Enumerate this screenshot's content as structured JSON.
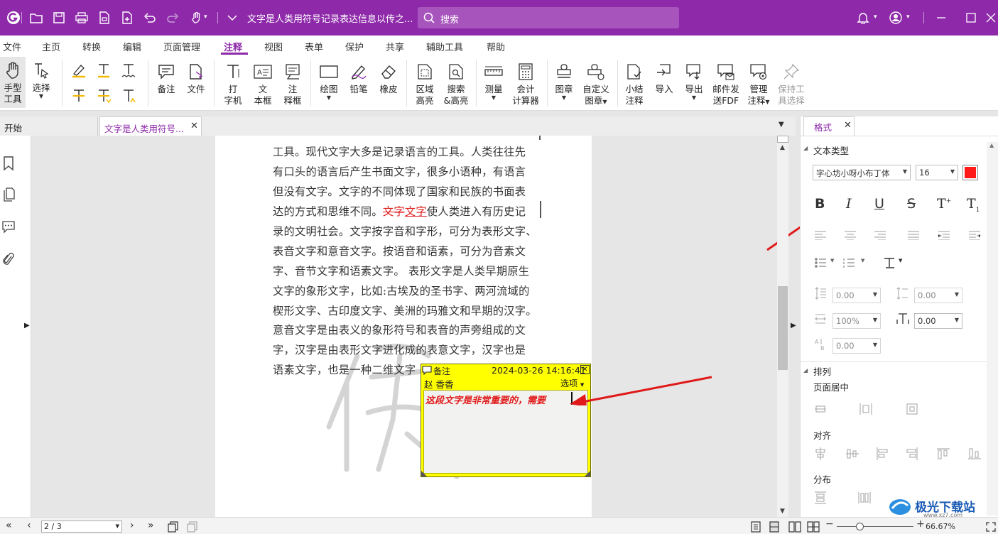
{
  "titlebar": {
    "doc_title": "文字是人类用符号记录表达信息以传之...",
    "search_placeholder": "搜索"
  },
  "menu": [
    "文件",
    "主页",
    "转换",
    "编辑",
    "页面管理",
    "注释",
    "视图",
    "表单",
    "保护",
    "共享",
    "辅助工具",
    "帮助"
  ],
  "toolbar": {
    "hand_l1": "手型",
    "hand_l2": "工具",
    "select": "选择",
    "note": "备注",
    "file": "文件",
    "typewriter_l1": "打",
    "typewriter_l2": "字机",
    "textbox_l1": "文",
    "textbox_l2": "本框",
    "callout_l1": "注",
    "callout_l2": "释框",
    "draw": "绘图",
    "pencil": "铅笔",
    "eraser": "橡皮",
    "area_l1": "区域",
    "area_l2": "高亮",
    "searchhl_l1": "搜索",
    "searchhl_l2": "&高亮",
    "measure": "测量",
    "calc_l1": "会计",
    "calc_l2": "计算器",
    "stamp": "图章",
    "customstamp_l1": "自定义",
    "customstamp_l2": "图章",
    "summary_l1": "小结",
    "summary_l2": "注释",
    "import": "导入",
    "export": "导出",
    "email_l1": "邮件发",
    "email_l2": "送FDF",
    "manage_l1": "管理",
    "manage_l2": "注释",
    "keep_l1": "保持工",
    "keep_l2": "具选择"
  },
  "tabs": {
    "home": "开始",
    "doc": "文字是人类用符号..."
  },
  "page_lines": [
    "工具。现代文字大多是记录语言的工具。人类往往先",
    "有口头的语言后产生书面文字，很多小语种，有语言",
    "但没有文字。文字的不同体现了国家和民族的书面表",
    "达的方式和思维不同。",
    "录的文明社会。文字按字音和字形，可分为表形文字、",
    "表音文字和意音文字。按语音和语素，可分为音素文",
    "字、音节文字和语素文字。 表形文字是人类早期原生",
    "文字的象形文字，比如:古埃及的圣书字、两河流域的",
    "楔形文字、古印度文字、美洲的玛雅文和早期的汉字。",
    "意音文字是由表义的象形符号和表音的声旁组成的文",
    "字，汉字是由表形文字进化成的表意文字，汉字也是",
    "语素文字，也是一种二维文字"
  ],
  "page_markup": {
    "strike": "文字",
    "underline": "文字",
    "after": "使人类进入有历史记"
  },
  "note": {
    "title": "备注",
    "datetime": "2024-03-26 14:16:41",
    "author": "赵 香香",
    "options": "选项",
    "content": "这段文字是非常重要的，需要"
  },
  "right_panel": {
    "tab": "格式",
    "text_type": "文本类型",
    "font": "字心坊小呀小布丁体",
    "size": "16",
    "text_color": "#ff1a1a",
    "line_spacing_1": "0.00",
    "line_spacing_2": "0.00",
    "scale": "100%",
    "char_space": "0.00",
    "word_space": "0.00",
    "arrange": "排列",
    "page_center": "页面居中",
    "align": "对齐",
    "distribute": "分布"
  },
  "status": {
    "page": "2 / 3",
    "zoom": "66.67%"
  },
  "watermark": {
    "text": "极光下载站",
    "url": "www.xz7.com"
  },
  "colors": {
    "accent": "#8e2aaa",
    "note_bg": "#ffff00",
    "arrow": "#e01a1a"
  }
}
